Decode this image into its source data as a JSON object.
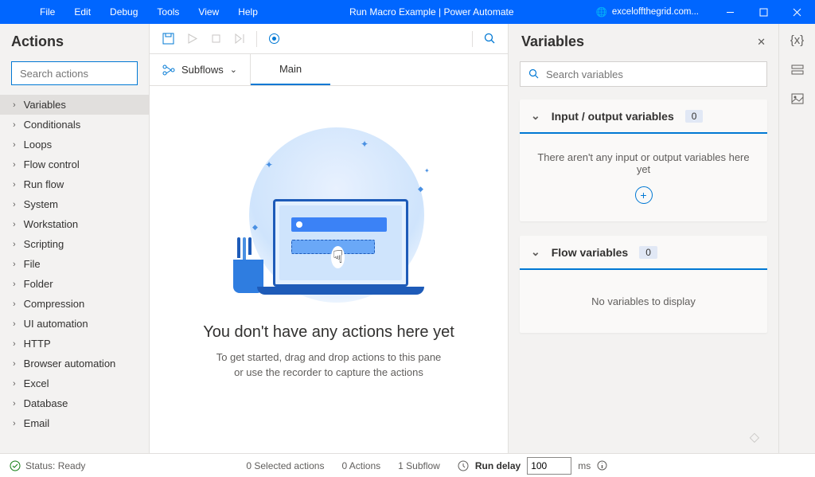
{
  "titlebar": {
    "menus": [
      "File",
      "Edit",
      "Debug",
      "Tools",
      "View",
      "Help"
    ],
    "title": "Run Macro Example | Power Automate",
    "site": "exceloffthegrid.com..."
  },
  "actions_panel": {
    "title": "Actions",
    "search_placeholder": "Search actions",
    "items": [
      "Variables",
      "Conditionals",
      "Loops",
      "Flow control",
      "Run flow",
      "System",
      "Workstation",
      "Scripting",
      "File",
      "Folder",
      "Compression",
      "UI automation",
      "HTTP",
      "Browser automation",
      "Excel",
      "Database",
      "Email"
    ]
  },
  "center": {
    "subflows_label": "Subflows",
    "main_tab": "Main",
    "empty_title": "You don't have any actions here yet",
    "empty_sub1": "To get started, drag and drop actions to this pane",
    "empty_sub2": "or use the recorder to capture the actions"
  },
  "vars_panel": {
    "title": "Variables",
    "search_placeholder": "Search variables",
    "io_title": "Input / output variables",
    "io_count": "0",
    "io_empty": "There aren't any input or output variables here yet",
    "flow_title": "Flow variables",
    "flow_count": "0",
    "flow_empty": "No variables to display"
  },
  "statusbar": {
    "status": "Status: Ready",
    "selected": "0 Selected actions",
    "actions": "0 Actions",
    "subflows": "1 Subflow",
    "run_delay_label": "Run delay",
    "run_delay_value": "100",
    "ms": "ms"
  }
}
